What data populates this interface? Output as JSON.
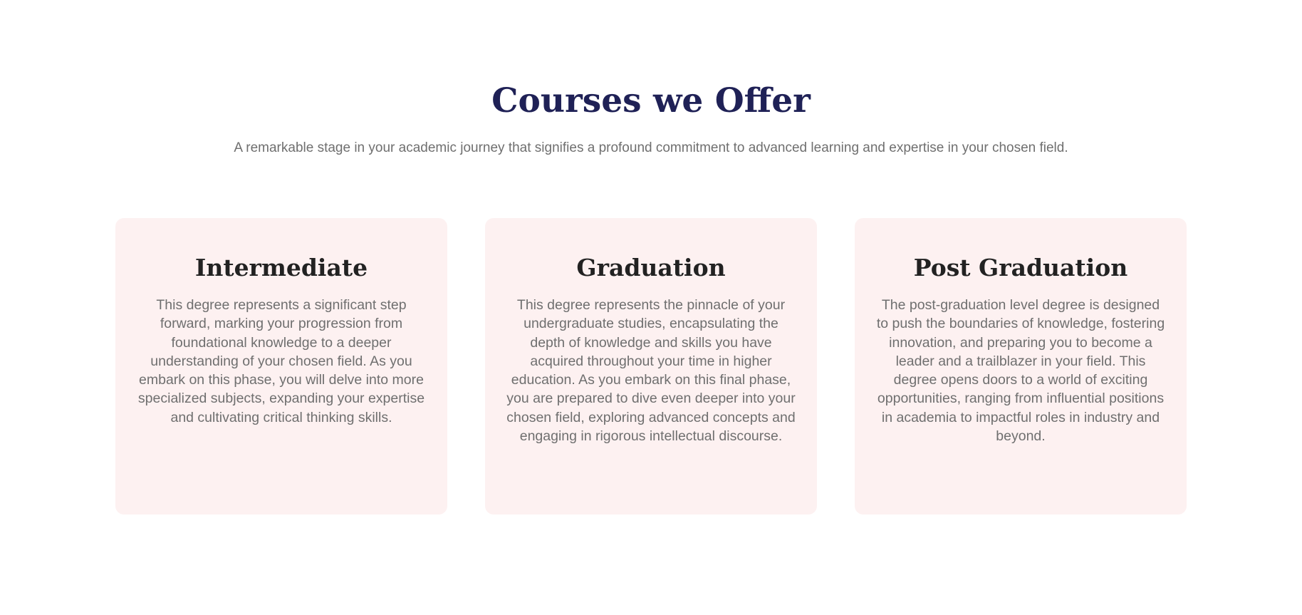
{
  "header": {
    "title": "Courses we Offer",
    "subtitle": "A remarkable stage in your academic journey that signifies a profound commitment to advanced learning and expertise in your chosen field."
  },
  "courses": [
    {
      "title": "Intermediate",
      "description": "This degree represents a significant step forward, marking your progression from foundational knowledge to a deeper understanding of your chosen field. As you embark on this phase, you will delve into more specialized subjects, expanding your expertise and cultivating critical thinking skills."
    },
    {
      "title": "Graduation",
      "description": "This degree represents the pinnacle of your undergraduate studies, encapsulating the depth of knowledge and skills you have acquired throughout your time in higher education. As you embark on this final phase, you are prepared to dive even deeper into your chosen field, exploring advanced concepts and engaging in rigorous intellectual discourse."
    },
    {
      "title": "Post Graduation",
      "description": "The post-graduation level degree is designed to push the boundaries of knowledge, fostering innovation, and preparing you to become a leader and a trailblazer in your field. This degree opens doors to a world of exciting opportunities, ranging from influential positions in academia to impactful roles in industry and beyond."
    }
  ],
  "colors": {
    "title": "#1f2156",
    "card_background": "#fdf1f1",
    "card_title": "#222222",
    "body_text": "#6f6f6f"
  }
}
